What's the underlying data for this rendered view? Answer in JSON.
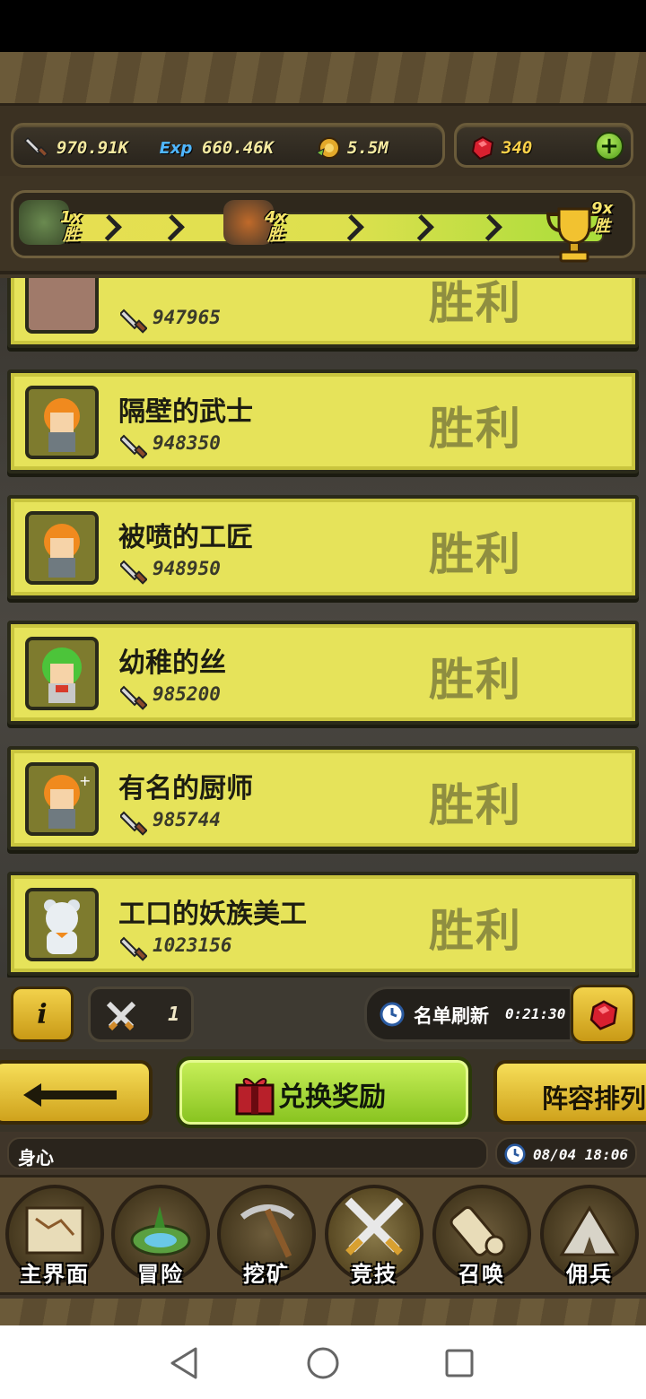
{
  "currency": {
    "attack": "970.91K",
    "exp": "660.46K",
    "exp_icon_label": "Exp",
    "gold": "5.5M",
    "gems": "340"
  },
  "progress": {
    "milestones": [
      {
        "mult": "1x",
        "label": "胜"
      },
      {
        "mult": "4x",
        "label": "胜"
      },
      {
        "mult": "9x",
        "label": "胜"
      }
    ]
  },
  "opponents": [
    {
      "name": "",
      "power": "947965",
      "result": "胜利"
    },
    {
      "name": "隔壁的武士",
      "power": "948350",
      "result": "胜利"
    },
    {
      "name": "被喷的工匠",
      "power": "948950",
      "result": "胜利"
    },
    {
      "name": "幼稚的丝",
      "power": "985200",
      "result": "胜利"
    },
    {
      "name": "有名的厨师",
      "power": "985744",
      "result": "胜利"
    },
    {
      "name": "工口的妖族美工",
      "power": "1023156",
      "result": "胜利"
    }
  ],
  "info": {
    "info_label": "i",
    "battle_count": "1",
    "refresh_label": "名单刷新",
    "refresh_time": "0:21:30"
  },
  "actions": {
    "exchange": "兑换奖励",
    "lineup": "阵容排列"
  },
  "footer": {
    "server": "身心",
    "datetime": "08/04 18:06"
  },
  "nav": [
    {
      "label": "主界面",
      "icon": "map-scroll-icon"
    },
    {
      "label": "冒险",
      "icon": "island-icon"
    },
    {
      "label": "挖矿",
      "icon": "pickaxe-icon"
    },
    {
      "label": "竞技",
      "icon": "crossed-swords-icon"
    },
    {
      "label": "召唤",
      "icon": "summon-scroll-icon"
    },
    {
      "label": "佣兵",
      "icon": "tent-icon"
    }
  ],
  "colors": {
    "card": "#e6e35a",
    "result_text": "#8f8e40",
    "accent_green": "#86c21e",
    "accent_gold": "#cfa21c"
  }
}
